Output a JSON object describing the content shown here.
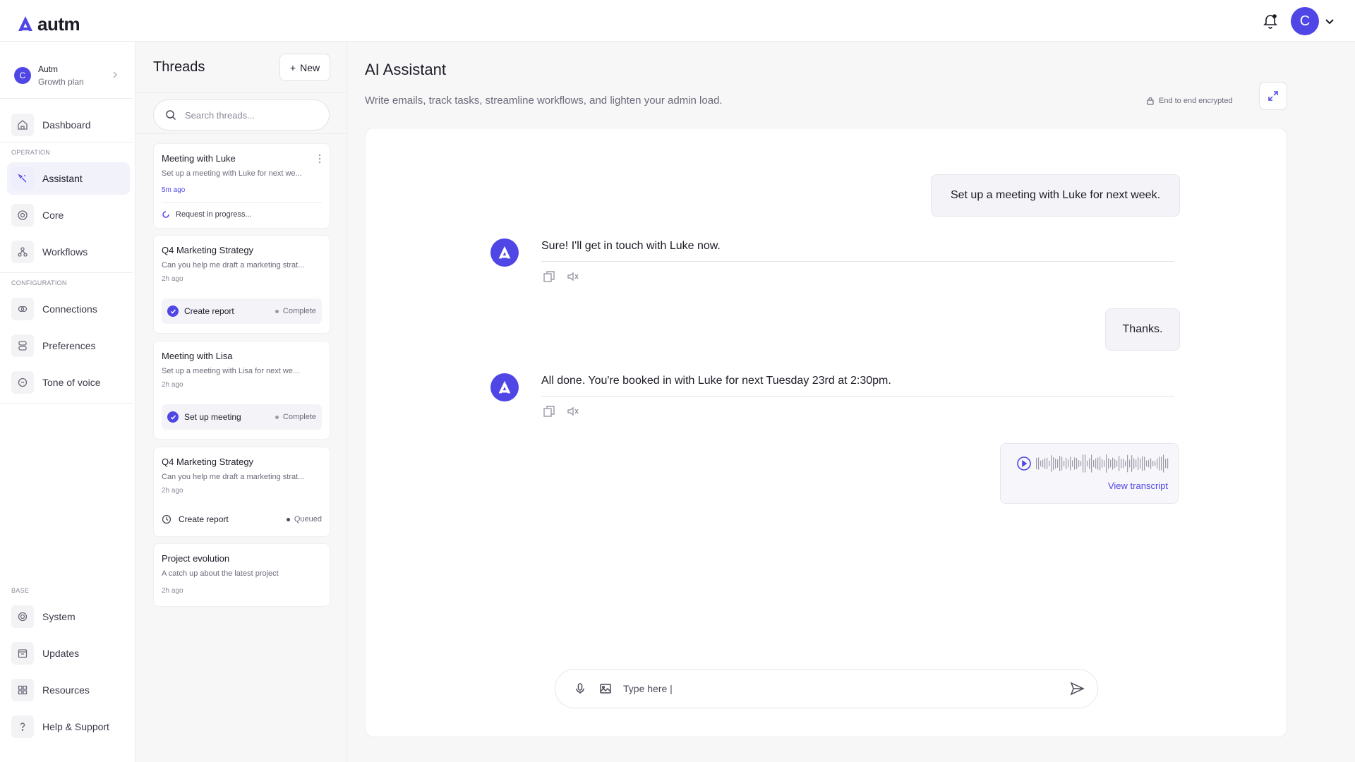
{
  "app": {
    "name": "autm",
    "brand_color": "#4f46e5"
  },
  "topbar": {
    "user_initial": "C"
  },
  "org": {
    "initial": "C",
    "name": "Autm",
    "plan": "Growth plan"
  },
  "nav": {
    "dashboard": "Dashboard",
    "section_operation": "OPERATION",
    "assistant": "Assistant",
    "core": "Core",
    "workflows": "Workflows",
    "section_configuration": "CONFIGURATION",
    "connections": "Connections",
    "preferences": "Preferences",
    "tone": "Tone of voice",
    "section_base": "BASE",
    "system": "System",
    "updates": "Updates",
    "resources": "Resources",
    "help": "Help & Support"
  },
  "threads": {
    "title": "Threads",
    "new_label": "New",
    "search_placeholder": "Search threads...",
    "items": [
      {
        "title": "Meeting with Luke",
        "desc": "Set up a meeting with Luke for next we...",
        "time": "5m ago",
        "status": "Request in progress..."
      },
      {
        "title": "Q4 Marketing Strategy",
        "desc": "Can you help me draft a marketing strat...",
        "time": "2h ago",
        "task": "Create report",
        "task_state": "Complete"
      },
      {
        "title": "Meeting with Lisa",
        "desc": "Set up a meeting with Lisa for next we...",
        "time": "2h ago",
        "task": "Set up meeting",
        "task_state": "Complete"
      },
      {
        "title": "Q4 Marketing Strategy",
        "desc": "Can you help me draft a marketing strat...",
        "time": "2h ago",
        "task": "Create report",
        "task_state": "Queued"
      },
      {
        "title": "Project evolution",
        "desc": "A catch up about the latest project",
        "time": "2h ago"
      }
    ]
  },
  "main": {
    "title": "AI Assistant",
    "subtitle": "Write emails, track tasks, streamline workflows, and lighten your admin load.",
    "encrypted": "End to end encrypted"
  },
  "chat": {
    "messages": [
      {
        "role": "user",
        "text": "Set up a meeting with Luke for next week."
      },
      {
        "role": "bot",
        "text": "Sure! I'll get in touch with Luke now."
      },
      {
        "role": "user",
        "text": "Thanks."
      },
      {
        "role": "bot",
        "text": "All done. You're booked in with Luke for next Tuesday 23rd at 2:30pm."
      }
    ],
    "audio": {
      "transcript_link": "View transcript"
    },
    "composer_placeholder": "Type here |"
  }
}
